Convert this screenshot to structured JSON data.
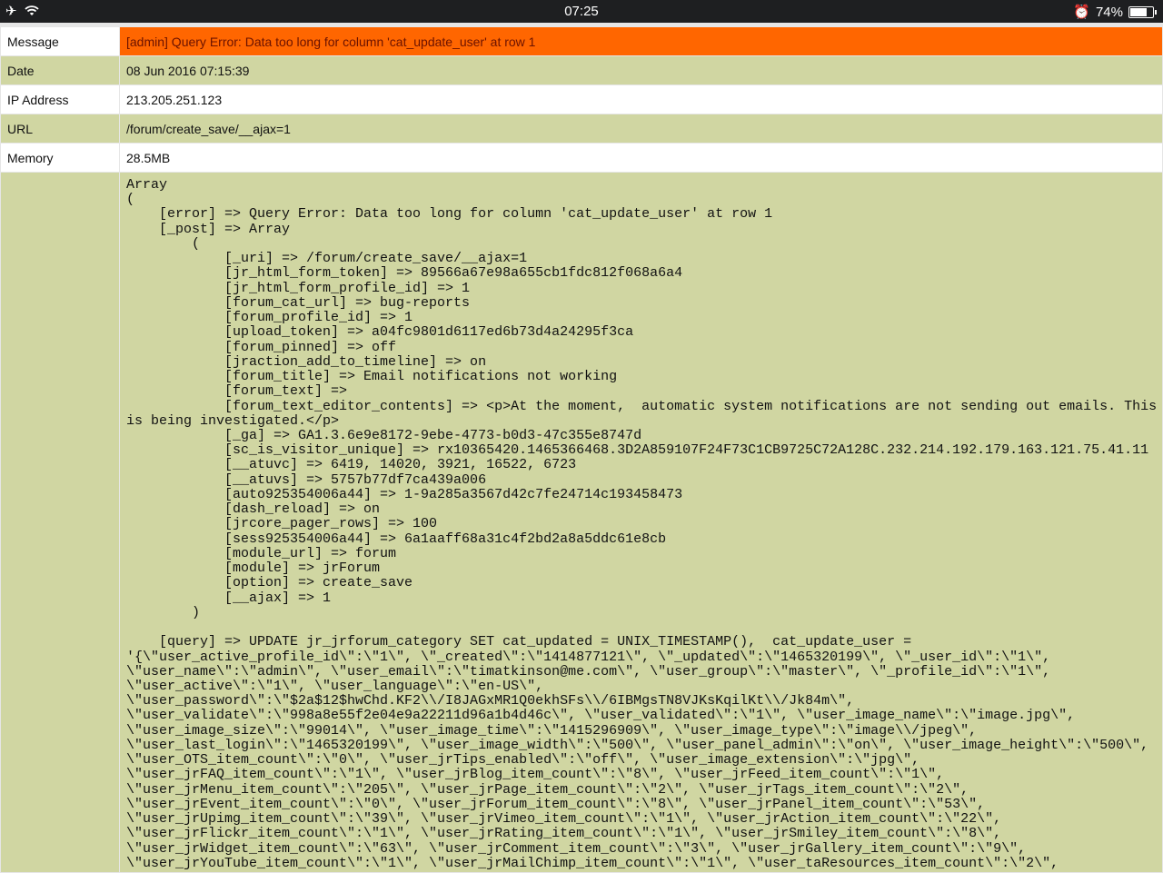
{
  "status_bar": {
    "time": "07:25",
    "battery": "74%",
    "battery_level": 0.74
  },
  "rows": [
    {
      "label": "Message",
      "value": "[admin] Query Error: Data too long for column 'cat_update_user' at row 1"
    },
    {
      "label": "Date",
      "value": "08 Jun 2016 07:15:39"
    },
    {
      "label": "IP Address",
      "value": "213.205.251.123"
    },
    {
      "label": "URL",
      "value": "/forum/create_save/__ajax=1"
    },
    {
      "label": "Memory",
      "value": "28.5MB"
    }
  ],
  "colors": {
    "error": "#ff6600",
    "green": "#d0d6a2"
  },
  "dump_lines": [
    "Array",
    "(",
    "    [error] => Query Error: Data too long for column 'cat_update_user' at row 1",
    "    [_post] => Array",
    "        (",
    "            [_uri] => /forum/create_save/__ajax=1",
    "            [jr_html_form_token] => 89566a67e98a655cb1fdc812f068a6a4",
    "            [jr_html_form_profile_id] => 1",
    "            [forum_cat_url] => bug-reports",
    "            [forum_profile_id] => 1",
    "            [upload_token] => a04fc9801d6117ed6b73d4a24295f3ca",
    "            [forum_pinned] => off",
    "            [jraction_add_to_timeline] => on",
    "            [forum_title] => Email notifications not working",
    "            [forum_text] => ",
    "            [forum_text_editor_contents] => <p>At the moment,  automatic system notifications are not sending out emails. This",
    "is being investigated.</p>",
    "            [_ga] => GA1.3.6e9e8172-9ebe-4773-b0d3-47c355e8747d",
    "            [sc_is_visitor_unique] => rx10365420.1465366468.3D2A859107F24F73C1CB9725C72A128C.232.214.192.179.163.121.75.41.11",
    "            [__atuvc] => 6419, 14020, 3921, 16522, 6723",
    "            [__atuvs] => 5757b77df7ca439a006",
    "            [auto925354006a44] => 1-9a285a3567d42c7fe24714c193458473",
    "            [dash_reload] => on",
    "            [jrcore_pager_rows] => 100",
    "            [sess925354006a44] => 6a1aaff68a31c4f2bd2a8a5ddc61e8cb",
    "            [module_url] => forum",
    "            [module] => jrForum",
    "            [option] => create_save",
    "            [__ajax] => 1",
    "        )",
    "",
    "    [query] => UPDATE jr_jrforum_category SET cat_updated = UNIX_TIMESTAMP(),  cat_update_user =",
    "'{\\\"user_active_profile_id\\\":\\\"1\\\", \\\"_created\\\":\\\"1414877121\\\", \\\"_updated\\\":\\\"1465320199\\\", \\\"_user_id\\\":\\\"1\\\",",
    "\\\"user_name\\\":\\\"admin\\\", \\\"user_email\\\":\\\"timatkinson@me.com\\\", \\\"user_group\\\":\\\"master\\\", \\\"_profile_id\\\":\\\"1\\\",",
    "\\\"user_active\\\":\\\"1\\\", \\\"user_language\\\":\\\"en-US\\\",",
    "\\\"user_password\\\":\\\"$2a$12$hwChd.KF2\\\\/I8JAGxMR1Q0ekhSFs\\\\/6IBMgsTN8VJKsKqilKt\\\\/Jk84m\\\",",
    "\\\"user_validate\\\":\\\"998a8e55f2e04e9a22211d96a1b4d46c\\\", \\\"user_validated\\\":\\\"1\\\", \\\"user_image_name\\\":\\\"image.jpg\\\",",
    "\\\"user_image_size\\\":\\\"99014\\\", \\\"user_image_time\\\":\\\"1415296909\\\", \\\"user_image_type\\\":\\\"image\\\\/jpeg\\\",",
    "\\\"user_last_login\\\":\\\"1465320199\\\", \\\"user_image_width\\\":\\\"500\\\", \\\"user_panel_admin\\\":\\\"on\\\", \\\"user_image_height\\\":\\\"500\\\",",
    "\\\"user_OTS_item_count\\\":\\\"0\\\", \\\"user_jrTips_enabled\\\":\\\"off\\\", \\\"user_image_extension\\\":\\\"jpg\\\",",
    "\\\"user_jrFAQ_item_count\\\":\\\"1\\\", \\\"user_jrBlog_item_count\\\":\\\"8\\\", \\\"user_jrFeed_item_count\\\":\\\"1\\\",",
    "\\\"user_jrMenu_item_count\\\":\\\"205\\\", \\\"user_jrPage_item_count\\\":\\\"2\\\", \\\"user_jrTags_item_count\\\":\\\"2\\\",",
    "\\\"user_jrEvent_item_count\\\":\\\"0\\\", \\\"user_jrForum_item_count\\\":\\\"8\\\", \\\"user_jrPanel_item_count\\\":\\\"53\\\",",
    "\\\"user_jrUpimg_item_count\\\":\\\"39\\\", \\\"user_jrVimeo_item_count\\\":\\\"1\\\", \\\"user_jrAction_item_count\\\":\\\"22\\\",",
    "\\\"user_jrFlickr_item_count\\\":\\\"1\\\", \\\"user_jrRating_item_count\\\":\\\"1\\\", \\\"user_jrSmiley_item_count\\\":\\\"8\\\",",
    "\\\"user_jrWidget_item_count\\\":\\\"63\\\", \\\"user_jrComment_item_count\\\":\\\"3\\\", \\\"user_jrGallery_item_count\\\":\\\"9\\\",",
    "\\\"user_jrYouTube_item_count\\\":\\\"1\\\", \\\"user_jrMailChimp_item_count\\\":\\\"1\\\", \\\"user_taResources_item_count\\\":\\\"2\\\","
  ]
}
